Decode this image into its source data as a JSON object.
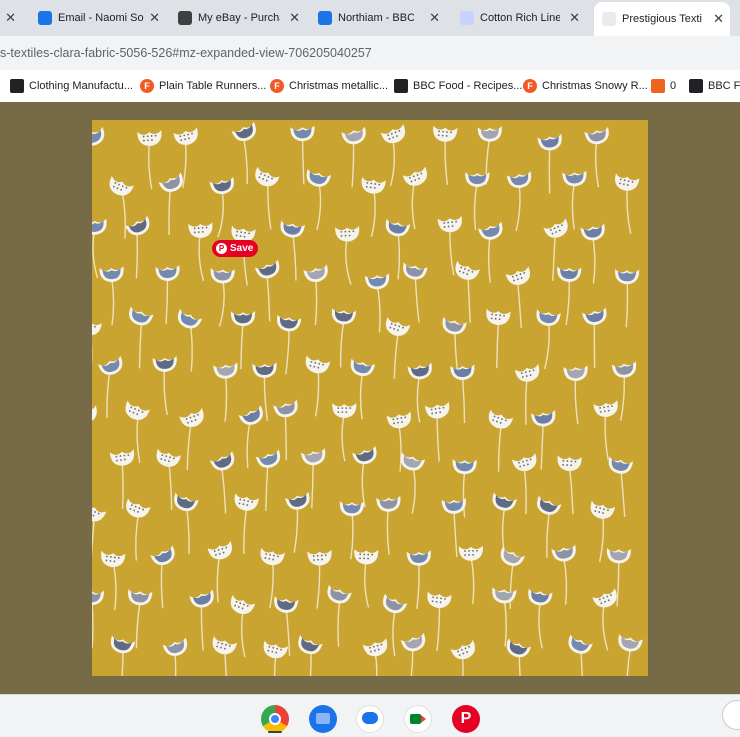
{
  "tabs": [
    {
      "title": "",
      "close": "✕"
    },
    {
      "title": "Email - Naomi So",
      "close": "✕"
    },
    {
      "title": "My eBay - Purcha",
      "close": "✕"
    },
    {
      "title": "Northiam - BBC W",
      "close": "✕"
    },
    {
      "title": "Cotton Rich Linen",
      "close": "✕"
    },
    {
      "title": "Prestigious Texti",
      "close": "✕"
    }
  ],
  "address": {
    "url": "s-textiles-clara-fabric-5056-526#mz-expanded-view-706205040257"
  },
  "bookmarks": [
    {
      "label": "Clothing Manufactu..."
    },
    {
      "label": "Plain Table Runners..."
    },
    {
      "label": "Christmas metallic..."
    },
    {
      "label": "BBC Food - Recipes..."
    },
    {
      "label": "Christmas Snowy R..."
    },
    {
      "label": "0"
    },
    {
      "label": "BBC Fo"
    }
  ],
  "pinterest": {
    "save_label": "Save"
  },
  "colors": {
    "page_bg": "#776a47",
    "fabric_bg": "#c9a431",
    "pin_red": "#e60023"
  },
  "shelf_apps": [
    "chrome-icon",
    "files-icon",
    "messages-icon",
    "meet-icon",
    "pinterest-icon"
  ]
}
